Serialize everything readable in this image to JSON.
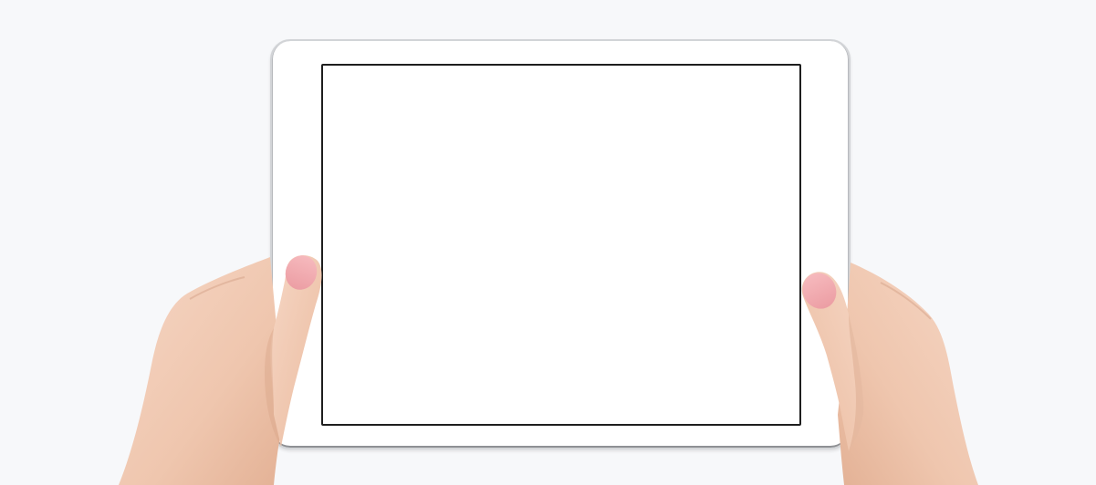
{
  "scene": {
    "background_color": "#f7f8fa",
    "tablet_color": "#ffffff",
    "bezel_border_color": "#d2d4d7",
    "screen_border_color": "#1e1e1e",
    "skin_color": "#f1cbb5",
    "nail_color": "#f0a8ad"
  }
}
